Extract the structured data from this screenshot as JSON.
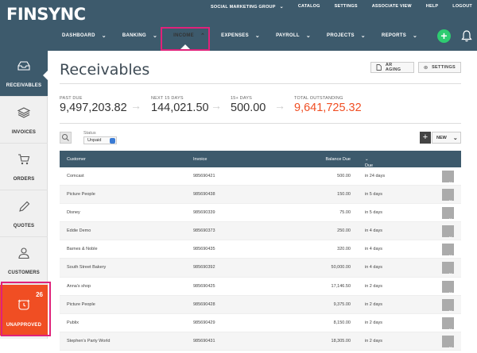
{
  "app": {
    "logo": "FINSYNC"
  },
  "top_links": [
    {
      "label": "SOCIAL MARKETING GROUP",
      "chevron": true
    },
    {
      "label": "CATALOG"
    },
    {
      "label": "SETTINGS"
    },
    {
      "label": "ASSOCIATE VIEW"
    },
    {
      "label": "HELP"
    },
    {
      "label": "LOGOUT"
    }
  ],
  "main_nav": [
    {
      "label": "DASHBOARD"
    },
    {
      "label": "BANKING"
    },
    {
      "label": "INCOME"
    },
    {
      "label": "EXPENSES"
    },
    {
      "label": "PAYROLL"
    },
    {
      "label": "PROJECTS"
    },
    {
      "label": "REPORTS"
    }
  ],
  "sidebar": [
    {
      "label": "RECEIVABLES",
      "icon": "inbox-icon"
    },
    {
      "label": "INVOICES",
      "icon": "layers-icon"
    },
    {
      "label": "ORDERS",
      "icon": "cart-icon"
    },
    {
      "label": "QUOTES",
      "icon": "pencil-icon"
    },
    {
      "label": "CUSTOMERS",
      "icon": "person-icon"
    },
    {
      "label": "UNAPPROVED",
      "icon": "alarm-clock-icon",
      "count": "26"
    }
  ],
  "page": {
    "title": "Receivables",
    "ar_aging_label": "AR AGING",
    "settings_label": "SETTINGS"
  },
  "stats": [
    {
      "label": "PAST DUE",
      "value": "9,497,203.82"
    },
    {
      "label": "NEXT 15 DAYS",
      "value": "144,021.50"
    },
    {
      "label": "15+ DAYS",
      "value": "500.00"
    },
    {
      "label": "TOTAL OUTSTANDING",
      "value": "9,641,725.32"
    }
  ],
  "filter": {
    "status_label": "Status",
    "status_value": "Unpaid",
    "new_label": "NEW"
  },
  "table": {
    "headers": {
      "customer": "Customer",
      "invoice": "Invoice",
      "balance": "Balance Due",
      "due": "Due"
    },
    "rows": [
      {
        "customer": "Comcast",
        "invoice": "985690421",
        "balance": "500.00",
        "due": "in 24 days"
      },
      {
        "customer": "Picture People",
        "invoice": "985690438",
        "balance": "150.00",
        "due": "in 5 days"
      },
      {
        "customer": "Disney",
        "invoice": "985690339",
        "balance": "75.00",
        "due": "in 5 days"
      },
      {
        "customer": "Eddie Demo",
        "invoice": "985690373",
        "balance": "250.00",
        "due": "in 4 days"
      },
      {
        "customer": "Barnes & Noble",
        "invoice": "985690435",
        "balance": "320.00",
        "due": "in 4 days"
      },
      {
        "customer": "South Street Bakery",
        "invoice": "985690392",
        "balance": "50,000.00",
        "due": "in 4 days"
      },
      {
        "customer": "Anna's shop",
        "invoice": "985690425",
        "balance": "17,146.50",
        "due": "in 2 days"
      },
      {
        "customer": "Picture People",
        "invoice": "985690428",
        "balance": "9,375.00",
        "due": "in 2 days"
      },
      {
        "customer": "Publix",
        "invoice": "985690429",
        "balance": "8,150.00",
        "due": "in 2 days"
      },
      {
        "customer": "Stephen's Party World",
        "invoice": "985690431",
        "balance": "18,305.00",
        "due": "in 2 days"
      }
    ]
  },
  "colors": {
    "header": "#3d5a6c",
    "accent": "#f04e23",
    "highlight": "#e0227a",
    "add": "#2ecc71"
  }
}
